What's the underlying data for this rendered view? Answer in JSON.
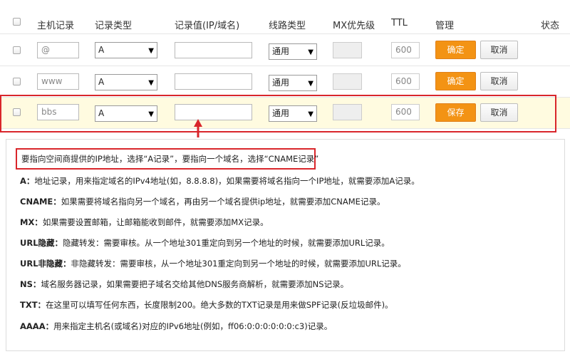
{
  "header": {
    "host": "主机记录",
    "type": "记录类型",
    "value": "记录值(IP/域名)",
    "line": "线路类型",
    "mx": "MX优先级",
    "ttl": "TTL",
    "manage": "管理",
    "status": "状态"
  },
  "rows": [
    {
      "host": "@",
      "type": "A",
      "value": "",
      "line": "通用",
      "mx": "",
      "ttl": "600",
      "action": "确定",
      "cancel": "取消"
    },
    {
      "host": "www",
      "type": "A",
      "value": "",
      "line": "通用",
      "mx": "",
      "ttl": "600",
      "action": "确定",
      "cancel": "取消"
    },
    {
      "host": "bbs",
      "type": "A",
      "value": "",
      "line": "通用",
      "mx": "",
      "ttl": "600",
      "action": "保存",
      "cancel": "取消"
    }
  ],
  "hint": "要指向空间商提供的IP地址，选择“A记录”，要指向一个域名，选择“CNAME记录”",
  "descriptions": [
    {
      "key": "A：",
      "text": "地址记录，用来指定域名的IPv4地址(如，8.8.8.8)，如果需要将域名指向一个IP地址，就需要添加A记录。"
    },
    {
      "key": "CNAME：",
      "text": "如果需要将域名指向另一个域名，再由另一个域名提供ip地址，就需要添加CNAME记录。"
    },
    {
      "key": "MX：",
      "text": "如果需要设置邮箱，让邮箱能收到邮件，就需要添加MX记录。"
    },
    {
      "key": "URL隐藏：",
      "text": "隐藏转发：需要审核。从一个地址301重定向到另一个地址的时候，就需要添加URL记录。"
    },
    {
      "key": "URL非隐藏：",
      "text": "非隐藏转发：需要审核，从一个地址301重定向到另一个地址的时候，就需要添加URL记录。"
    },
    {
      "key": "NS：",
      "text": "域名服务器记录，如果需要把子域名交给其他DNS服务商解析，就需要添加NS记录。"
    },
    {
      "key": "TXT：",
      "text": "在这里可以填写任何东西，长度限制200。绝大多数的TXT记录是用来做SPF记录(反垃圾邮件)。"
    },
    {
      "key": "AAAA：",
      "text": "用来指定主机名(或域名)对应的IPv6地址(例如，ff06:0:0:0:0:0:0:c3)记录。"
    }
  ],
  "colors": {
    "accent": "#f39314",
    "highlight": "#fffbe0",
    "annotation": "#d9262b"
  }
}
